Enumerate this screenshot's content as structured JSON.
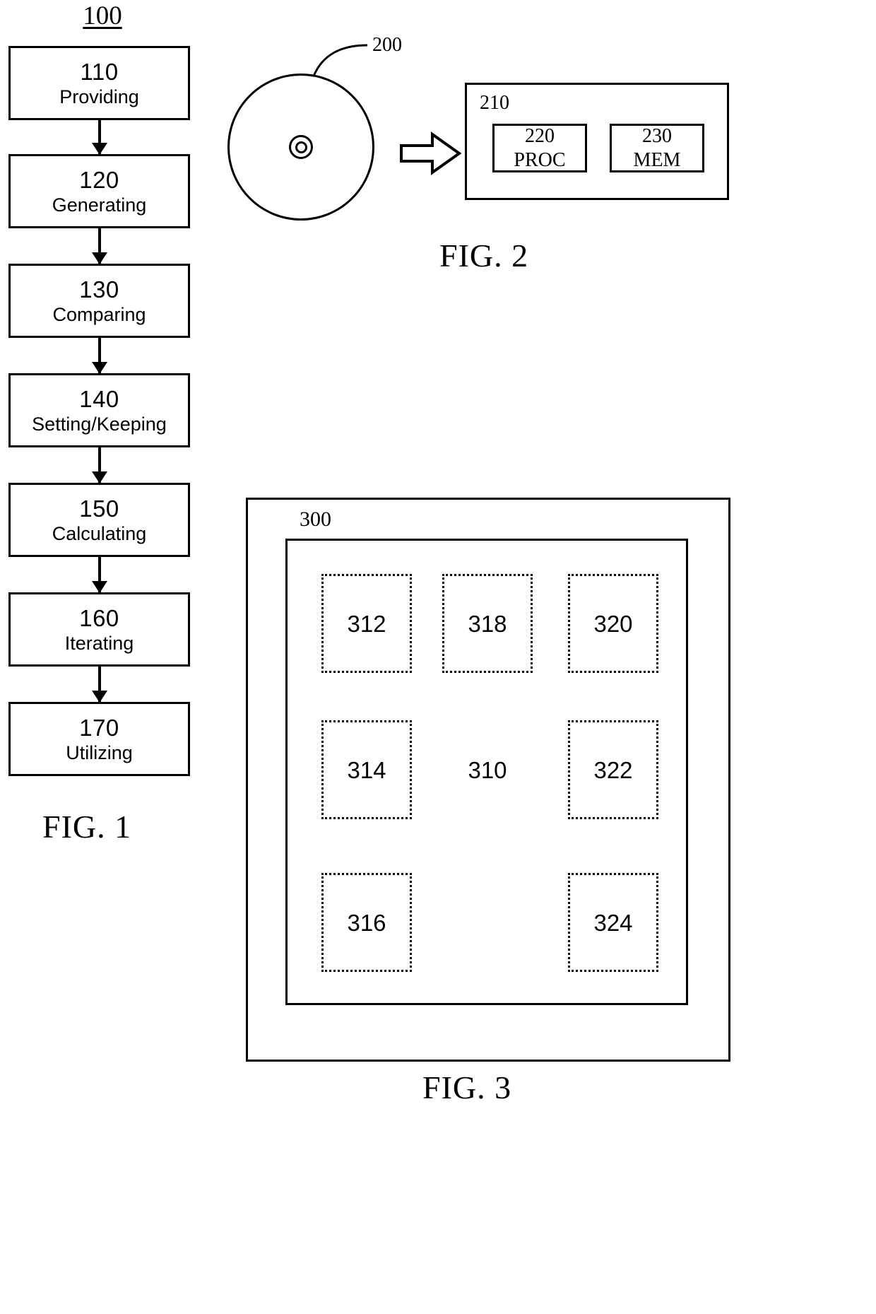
{
  "figure1": {
    "ref_label": "100",
    "caption": "FIG. 1",
    "steps": [
      {
        "number": "110",
        "label": "Providing"
      },
      {
        "number": "120",
        "label": "Generating"
      },
      {
        "number": "130",
        "label": "Comparing"
      },
      {
        "number": "140",
        "label": "Setting/Keeping"
      },
      {
        "number": "150",
        "label": "Calculating"
      },
      {
        "number": "160",
        "label": "Iterating"
      },
      {
        "number": "170",
        "label": "Utilizing"
      }
    ]
  },
  "figure2": {
    "caption": "FIG. 2",
    "disc_ref": "200",
    "computer_ref": "210",
    "components": [
      {
        "number": "220",
        "label": "PROC"
      },
      {
        "number": "230",
        "label": "MEM"
      }
    ]
  },
  "figure3": {
    "caption": "FIG. 3",
    "outer_ref": "300",
    "center_ref": "310",
    "cells": [
      {
        "number": "312",
        "style": "dotted"
      },
      {
        "number": "318",
        "style": "dotted"
      },
      {
        "number": "320",
        "style": "dotted"
      },
      {
        "number": "314",
        "style": "dotted"
      },
      {
        "number": "310",
        "style": "plain"
      },
      {
        "number": "322",
        "style": "dotted"
      },
      {
        "number": "316",
        "style": "dotted"
      },
      {
        "number": "324",
        "style": "dotted"
      }
    ]
  },
  "colors": {
    "ink": "#000000",
    "paper": "#ffffff"
  }
}
